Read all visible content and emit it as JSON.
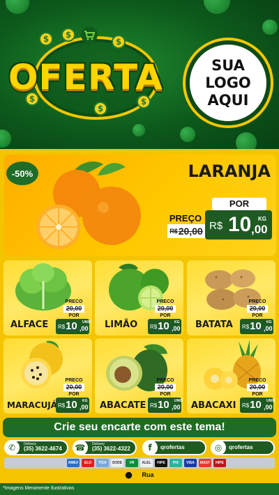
{
  "header": {
    "title": "OFERTA",
    "logo_lines": [
      "SUA",
      "LOGO",
      "AQUI"
    ],
    "coin_symbol": "$"
  },
  "featured": {
    "discount": "-50%",
    "name": "LARANJA",
    "preco_label": "PREÇO",
    "old_currency": "R$",
    "old_price": "20,00",
    "por_label": "POR",
    "currency": "R$",
    "price_int": "10",
    "price_dec": ",00",
    "unit": "KG"
  },
  "products": [
    {
      "name": "ALFACE",
      "preco_label": "PRECO",
      "old_price": "20,00",
      "por_label": "POR",
      "currency": "R$",
      "price_int": "10",
      "price_dec": ",00",
      "unit": "UNID"
    },
    {
      "name": "LIMÃO",
      "preco_label": "PRECO",
      "old_price": "20,00",
      "por_label": "POR",
      "currency": "R$",
      "price_int": "10",
      "price_dec": ",00",
      "unit": "KG"
    },
    {
      "name": "BATATA",
      "preco_label": "PRECO",
      "old_price": "20,00",
      "por_label": "POR",
      "currency": "R$",
      "price_int": "10",
      "price_dec": ",00",
      "unit": "KG"
    },
    {
      "name": "MARACUJÁ",
      "preco_label": "PRECO",
      "old_price": "20,00",
      "por_label": "POR",
      "currency": "R$",
      "price_int": "10",
      "price_dec": ",00",
      "unit": "KG"
    },
    {
      "name": "ABACATE",
      "preco_label": "PRECO",
      "old_price": "20,00",
      "por_label": "POR",
      "currency": "R$",
      "price_int": "10",
      "price_dec": ",00",
      "unit": "UNID"
    },
    {
      "name": "ABACAXI",
      "preco_label": "PRECO",
      "old_price": "20,00",
      "por_label": "POR",
      "currency": "R$",
      "price_int": "10",
      "price_dec": ",00",
      "unit": "UNID"
    }
  ],
  "footer": {
    "cta": "Crie seu encarte com este tema!",
    "contacts": [
      {
        "icon": "whatsapp-icon",
        "small": "Delivery",
        "text": "(35) 3622-4674"
      },
      {
        "icon": "phone-icon",
        "small": "Delivery",
        "text": "(35) 3622-4322"
      },
      {
        "icon": "facebook-icon",
        "text": "qrofertas"
      },
      {
        "icon": "instagram-icon",
        "text": "qrofertas"
      }
    ],
    "payment_methods": [
      {
        "label": "AMEX",
        "color": "#2a6fc9"
      },
      {
        "label": "ELO",
        "color": "#d22"
      },
      {
        "label": "TICKET",
        "color": "#7aa9d6"
      },
      {
        "label": "SODEXO",
        "color": "#e9eef5"
      },
      {
        "label": "VR",
        "color": "#0a8f3a"
      },
      {
        "label": "ALELO",
        "color": "#eceff4"
      },
      {
        "label": "HIPER",
        "color": "#111"
      },
      {
        "label": "PIX",
        "color": "#27b5a0"
      },
      {
        "label": "VISA",
        "color": "#1a3aa8"
      },
      {
        "label": "MASTERCARD",
        "color": "#e83a2a"
      },
      {
        "label": "HIPERCARD",
        "color": "#b51b1b"
      }
    ],
    "address": "Rua",
    "disclaimer": "*Imagens Meramente Ilustrativas"
  },
  "colors": {
    "brand_green": "#1e6c28",
    "dark_green": "#1e5a22",
    "yellow": "#f4c400",
    "orange": "#ffad00"
  }
}
